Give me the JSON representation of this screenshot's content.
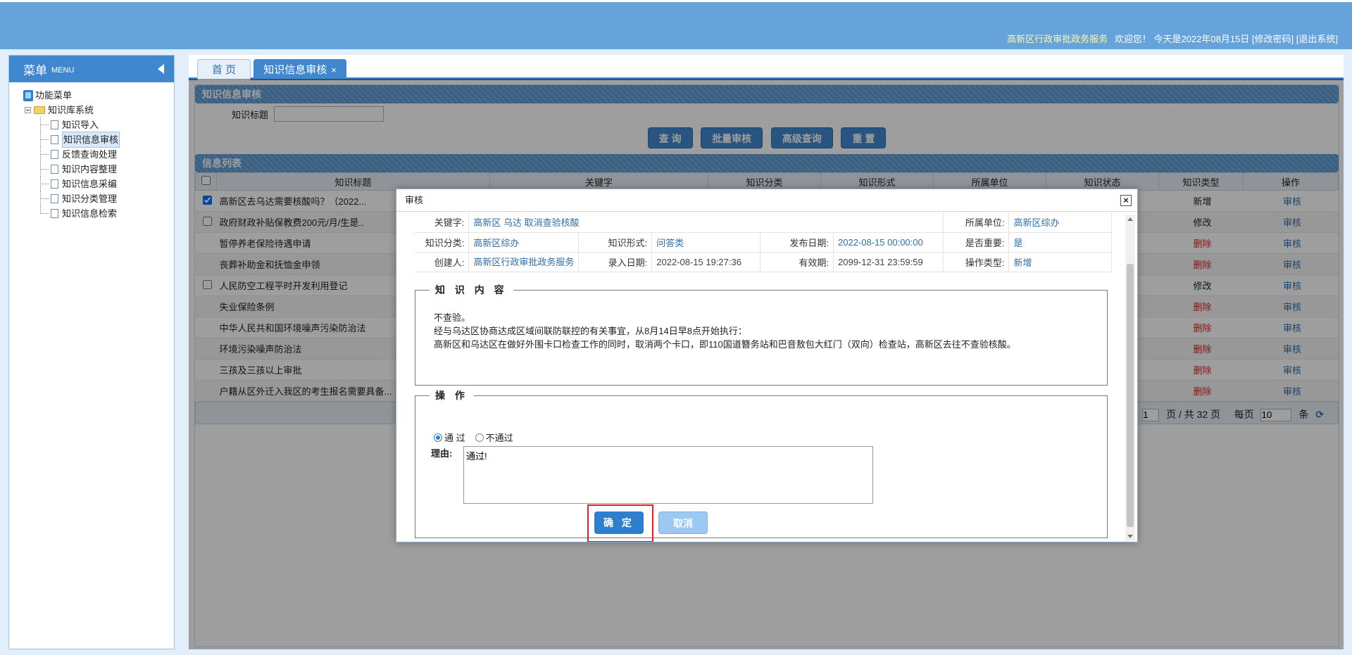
{
  "header": {
    "org": "高新区行政审批政务服务",
    "welcome": "欢迎您！",
    "today": "今天是2022年08月15日",
    "change_password": "[修改密码]",
    "logout": "[退出系统]"
  },
  "sidebar": {
    "title": "菜单",
    "title_en": "MENU",
    "root": "功能菜单",
    "group": "知识库系统",
    "items": [
      "知识导入",
      "知识信息审核",
      "反馈查询处理",
      "知识内容整理",
      "知识信息采编",
      "知识分类管理",
      "知识信息检索"
    ]
  },
  "tabs": {
    "home": "首 页",
    "active": "知识信息审核",
    "close": "×"
  },
  "search": {
    "panel_title": "知识信息审核",
    "title_label": "知识标题",
    "title_value": "",
    "buttons": [
      "查 询",
      "批量审核",
      "高级查询",
      "重 置"
    ]
  },
  "list": {
    "panel_title": "信息列表",
    "columns": [
      "知识标题",
      "关键字",
      "知识分类",
      "知识形式",
      "所属单位",
      "知识状态",
      "知识类型",
      "操作"
    ],
    "rows": [
      {
        "title": "高新区去乌达需要核酸吗？（2022...",
        "type": "新增",
        "op": "审核",
        "checkbox": true,
        "checked": true
      },
      {
        "title": "政府财政补贴保教费200元/月/生是..",
        "type": "修改",
        "op": "审核",
        "checkbox": true,
        "checked": false
      },
      {
        "title": "暂停养老保险待遇申请",
        "type": "删除",
        "op": "审核",
        "checkbox": false,
        "checked": false
      },
      {
        "title": "丧葬补助金和抚恤金申领",
        "type": "删除",
        "op": "审核",
        "checkbox": false,
        "checked": false
      },
      {
        "title": "人民防空工程平时开发利用登记",
        "type": "修改",
        "op": "审核",
        "checkbox": true,
        "checked": false
      },
      {
        "title": "失业保险条例",
        "type": "删除",
        "op": "审核",
        "checkbox": false,
        "checked": false
      },
      {
        "title": "中华人民共和国环境噪声污染防治法",
        "type": "删除",
        "op": "审核",
        "checkbox": false,
        "checked": false
      },
      {
        "title": "环境污染噪声防治法",
        "type": "删除",
        "op": "审核",
        "checkbox": false,
        "checked": false
      },
      {
        "title": "三孩及三孩以上审批",
        "type": "删除",
        "op": "审核",
        "checkbox": false,
        "checked": false
      },
      {
        "title": "户籍从区外迁入我区的考生报名需要具备...",
        "type": "删除",
        "op": "审核",
        "checkbox": false,
        "checked": false
      }
    ],
    "pager": {
      "page": "1",
      "page_text": "页 / 共 32 页",
      "per_page_label": "每页",
      "per_page": "10",
      "unit": "条"
    }
  },
  "dialog": {
    "title": "审核",
    "close": "×",
    "meta": {
      "keyword_label": "关键字:",
      "keyword": "高新区 乌达 取消查验核酸",
      "unit_label": "所属单位:",
      "unit": "高新区综办",
      "category_label": "知识分类:",
      "category": "高新区综办",
      "form_label": "知识形式:",
      "form": "问答类",
      "publish_label": "发布日期:",
      "publish": "2022-08-15 00:00:00",
      "important_label": "是否重要:",
      "important": "是",
      "creator_label": "创建人:",
      "creator": "高新区行政审批政务服务",
      "entry_label": "录入日期:",
      "entry": "2022-08-15 19:27:36",
      "valid_label": "有效期:",
      "valid": "2099-12-31 23:59:59",
      "optype_label": "操作类型:",
      "optype": "新增"
    },
    "content_legend": "知 识 内 容",
    "content_lines": [
      "不查验。",
      "经与乌达区协商达成区域间联防联控的有关事宜，从8月14日早8点开始执行：",
      "高新区和乌达区在做好外围卡口检查工作的同时，取消两个卡口，即110国道簪务站和巴音敖包大红门（双向）检查站，高新区去往不查验核酸。"
    ],
    "op_legend": "操 作",
    "pass_label": "通 过",
    "fail_label": "不通过",
    "reason_label": "理由:",
    "reason_value": "通过!",
    "ok_label": "确 定",
    "cancel_label": "取消"
  }
}
